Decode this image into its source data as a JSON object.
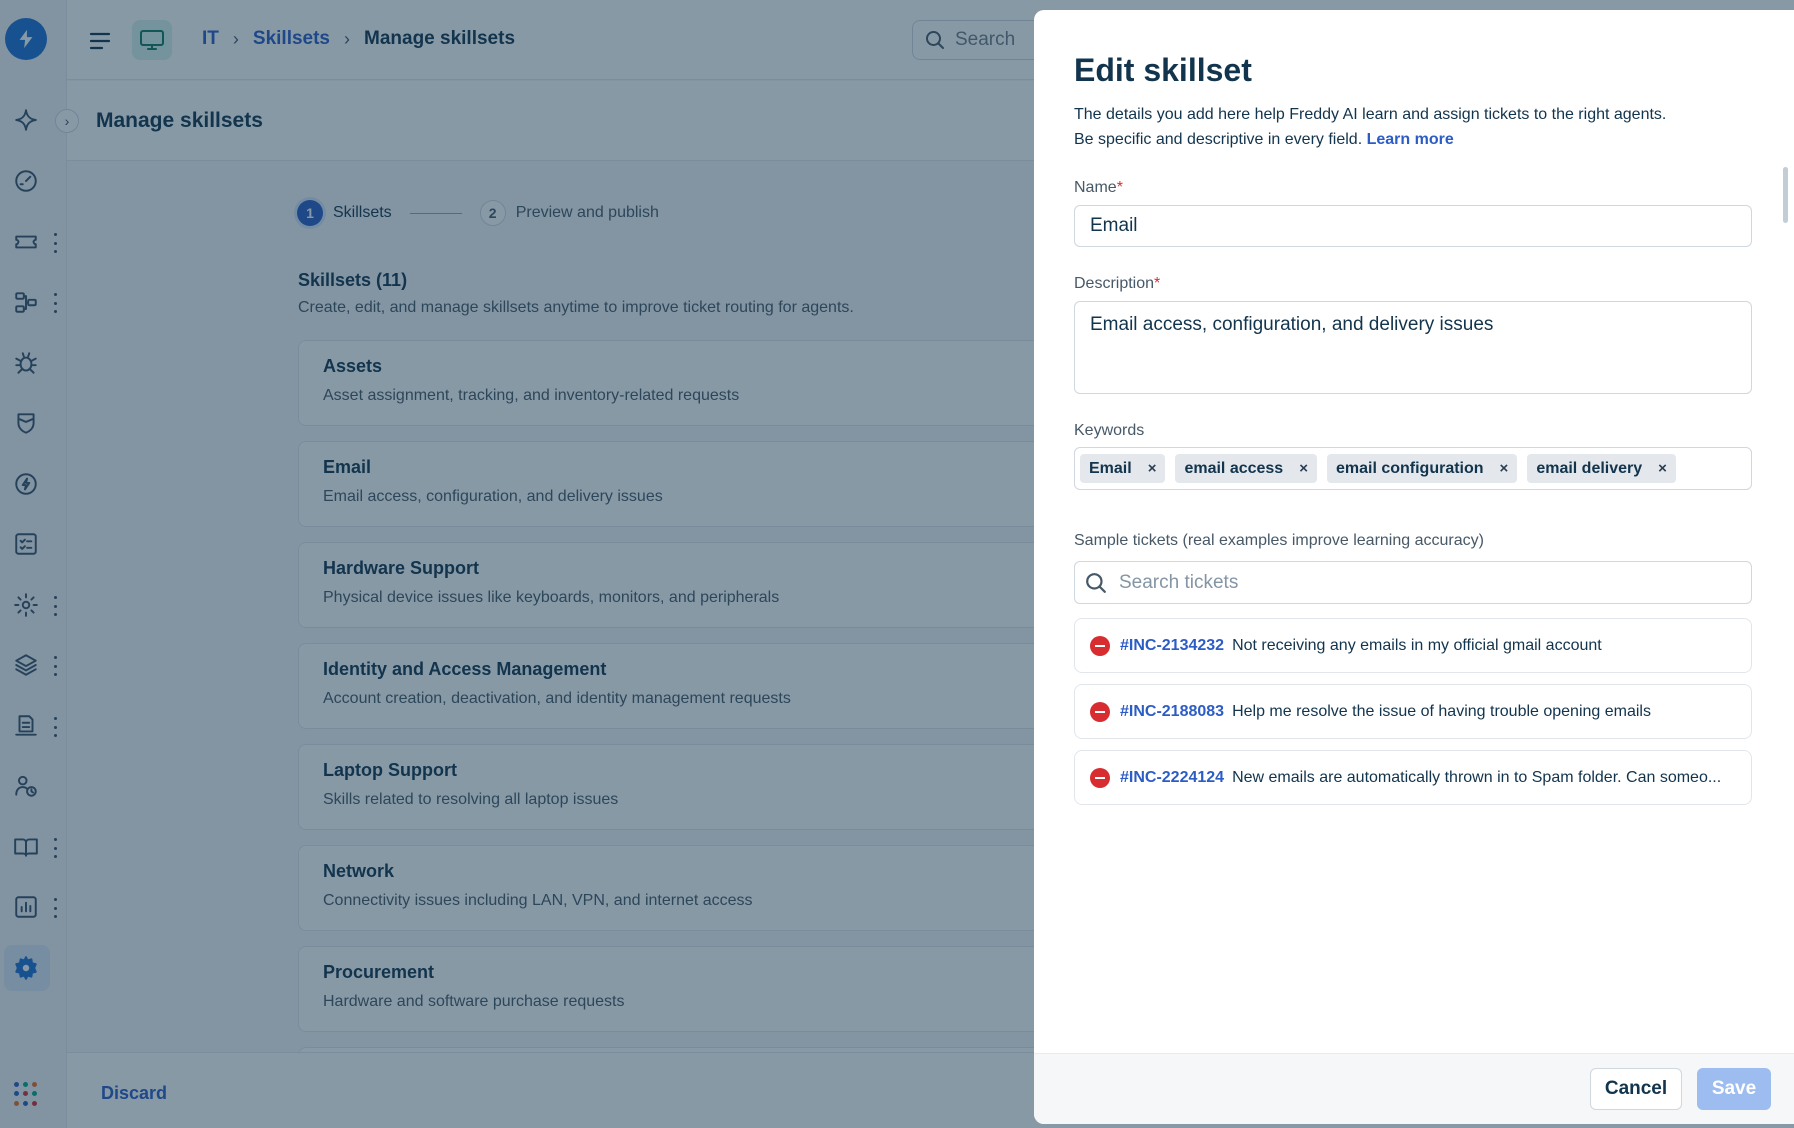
{
  "topbar": {
    "breadcrumb": [
      "IT",
      "Skillsets",
      "Manage skillsets"
    ],
    "search_placeholder": "Search"
  },
  "page": {
    "title": "Manage skillsets",
    "stepper": [
      {
        "num": "1",
        "label": "Skillsets",
        "active": true
      },
      {
        "num": "2",
        "label": "Preview and publish",
        "active": false
      }
    ],
    "skillsets_title": "Skillsets (11)",
    "skillsets_subtitle": "Create, edit, and manage skillsets anytime to improve ticket routing for agents.",
    "skillsets": [
      {
        "name": "Assets",
        "desc": "Asset assignment, tracking, and inventory-related requests"
      },
      {
        "name": "Email",
        "desc": "Email access, configuration, and delivery issues"
      },
      {
        "name": "Hardware Support",
        "desc": "Physical device issues like keyboards, monitors, and peripherals"
      },
      {
        "name": "Identity and Access Management",
        "desc": "Account creation, deactivation, and identity management requests"
      },
      {
        "name": "Laptop Support",
        "desc": "Skills related to resolving all laptop issues"
      },
      {
        "name": "Network",
        "desc": "Connectivity issues including LAN, VPN, and internet access"
      },
      {
        "name": "Procurement",
        "desc": "Hardware and software purchase requests"
      }
    ],
    "discard_label": "Discard"
  },
  "rail": {
    "icons": [
      "freddy-ai-icon",
      "dashboard-icon",
      "tickets-icon",
      "workflow-icon",
      "problems-icon",
      "changes-icon",
      "releases-icon",
      "tasks-icon",
      "automation-icon",
      "assets-icon",
      "inventory-icon",
      "teams-icon",
      "solutions-icon",
      "analytics-icon",
      "settings-icon"
    ],
    "brand_color": "#1f6fd1"
  },
  "drawer": {
    "title": "Edit skillset",
    "intro_line1": "The details you add here help Freddy AI learn and assign tickets to the right agents.",
    "intro_line2": "Be specific and descriptive in every field.",
    "learn_more": "Learn more",
    "name_label": "Name",
    "required_mark": "*",
    "name_value": "Email",
    "description_label": "Description",
    "description_value": "Email access, configuration, and delivery issues",
    "keywords_label": "Keywords",
    "keywords": [
      "Email",
      "email access",
      "email configuration",
      "email delivery"
    ],
    "remove_glyph": "×",
    "samples_label": "Sample tickets (real examples improve learning accuracy)",
    "samples_search_placeholder": "Search tickets",
    "tickets": [
      {
        "id": "#INC-2134232",
        "subject": "Not receiving any emails in my official gmail account"
      },
      {
        "id": "#INC-2188083",
        "subject": "Help me resolve the issue of having trouble opening emails"
      },
      {
        "id": "#INC-2224124",
        "subject": "New emails are automatically thrown in to Spam folder. Can someo..."
      }
    ],
    "cancel_label": "Cancel",
    "save_label": "Save"
  }
}
